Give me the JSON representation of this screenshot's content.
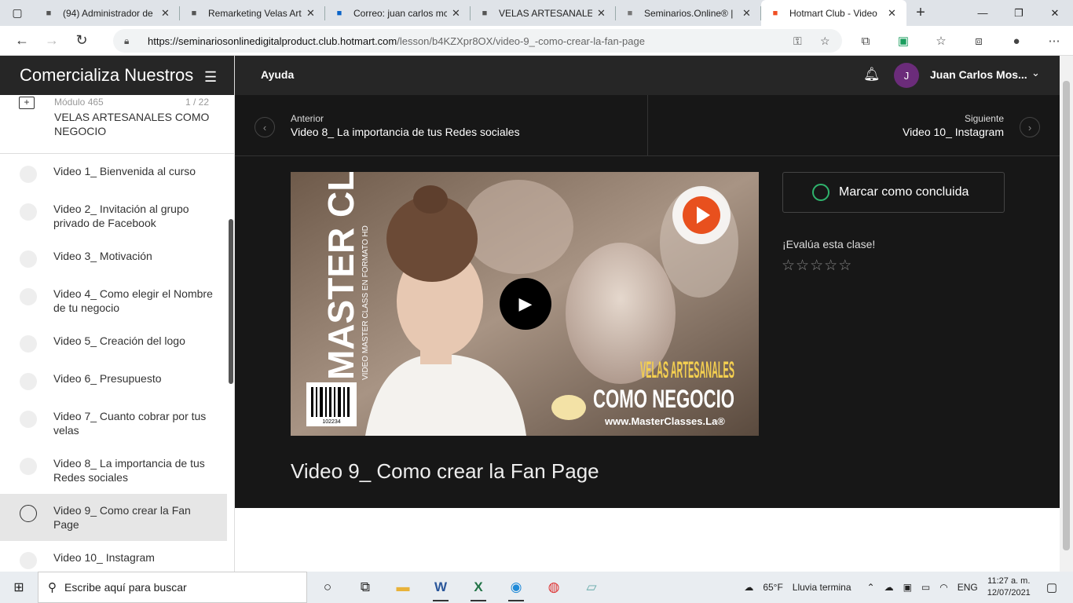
{
  "browser": {
    "tabs": [
      {
        "title": "(94) Administrador de",
        "favicon": "admin-icon"
      },
      {
        "title": "Remarketing Velas Art",
        "favicon": "doc-icon"
      },
      {
        "title": "Correo: juan carlos mc",
        "favicon": "outlook-icon"
      },
      {
        "title": "VELAS ARTESANALES",
        "favicon": "doc-icon"
      },
      {
        "title": "Seminarios.Online® |",
        "favicon": "seminarios-icon"
      },
      {
        "title": "Hotmart Club - Video",
        "favicon": "hotmart-icon",
        "active": true
      }
    ],
    "url_domain": "https://seminariosonlinedigitalproduct.club.hotmart.com",
    "url_path": "/lesson/b4KZXpr8OX/video-9_-como-crear-la-fan-page"
  },
  "sidebar": {
    "header_title": "Comercializa Nuestros",
    "module_number": "Módulo 465",
    "module_count": "1 / 22",
    "module_title": "VELAS ARTESANALES COMO NEGOCIO",
    "lessons": [
      {
        "label": "Video 1_ Bienvenida al curso"
      },
      {
        "label": "Video 2_ Invitación al grupo privado de Facebook"
      },
      {
        "label": "Video 3_ Motivación"
      },
      {
        "label": "Video 4_ Como elegir el Nombre de tu negocio"
      },
      {
        "label": "Video 5_ Creación del logo"
      },
      {
        "label": "Video 6_ Presupuesto"
      },
      {
        "label": "Video 7_ Cuanto cobrar por tus velas"
      },
      {
        "label": "Video 8_ La importancia de tus Redes sociales"
      },
      {
        "label": "Video 9_ Como crear la Fan Page",
        "current": true
      },
      {
        "label": "Video 10_ Instagram"
      }
    ]
  },
  "topbar": {
    "help": "Ayuda",
    "avatar_initial": "J",
    "user_name": "Juan Carlos Mos..."
  },
  "pager": {
    "prev_label": "Anterior",
    "prev_title": "Video 8_ La importancia de tus Redes sociales",
    "next_label": "Siguiente",
    "next_title": "Video 10_ Instagram"
  },
  "video": {
    "thumb_vertical_title": "MASTER CLASS",
    "thumb_vertical_subtitle": "VIDEO MASTER CLASS EN FORMATO HD",
    "thumb_headline_1": "VELAS ARTESANALES",
    "thumb_headline_2": "COMO NEGOCIO",
    "thumb_site": "www.MasterClasses.La®",
    "barcode_number": "102234",
    "title": "Video 9_ Como crear la Fan Page"
  },
  "actions": {
    "mark_done": "Marcar como concluida",
    "rate_prompt": "¡Evalúa esta clase!",
    "stars": 0
  },
  "taskbar": {
    "search_placeholder": "Escribe aquí para buscar",
    "weather_temp": "65°F",
    "weather_desc": "Lluvia termina",
    "lang": "ENG",
    "time": "11:27 a. m.",
    "date": "12/07/2021"
  },
  "colors": {
    "dark_header": "#262626",
    "main_bg": "#171717",
    "done_ring": "#2fb36d",
    "avatar": "#6b2c7a"
  }
}
